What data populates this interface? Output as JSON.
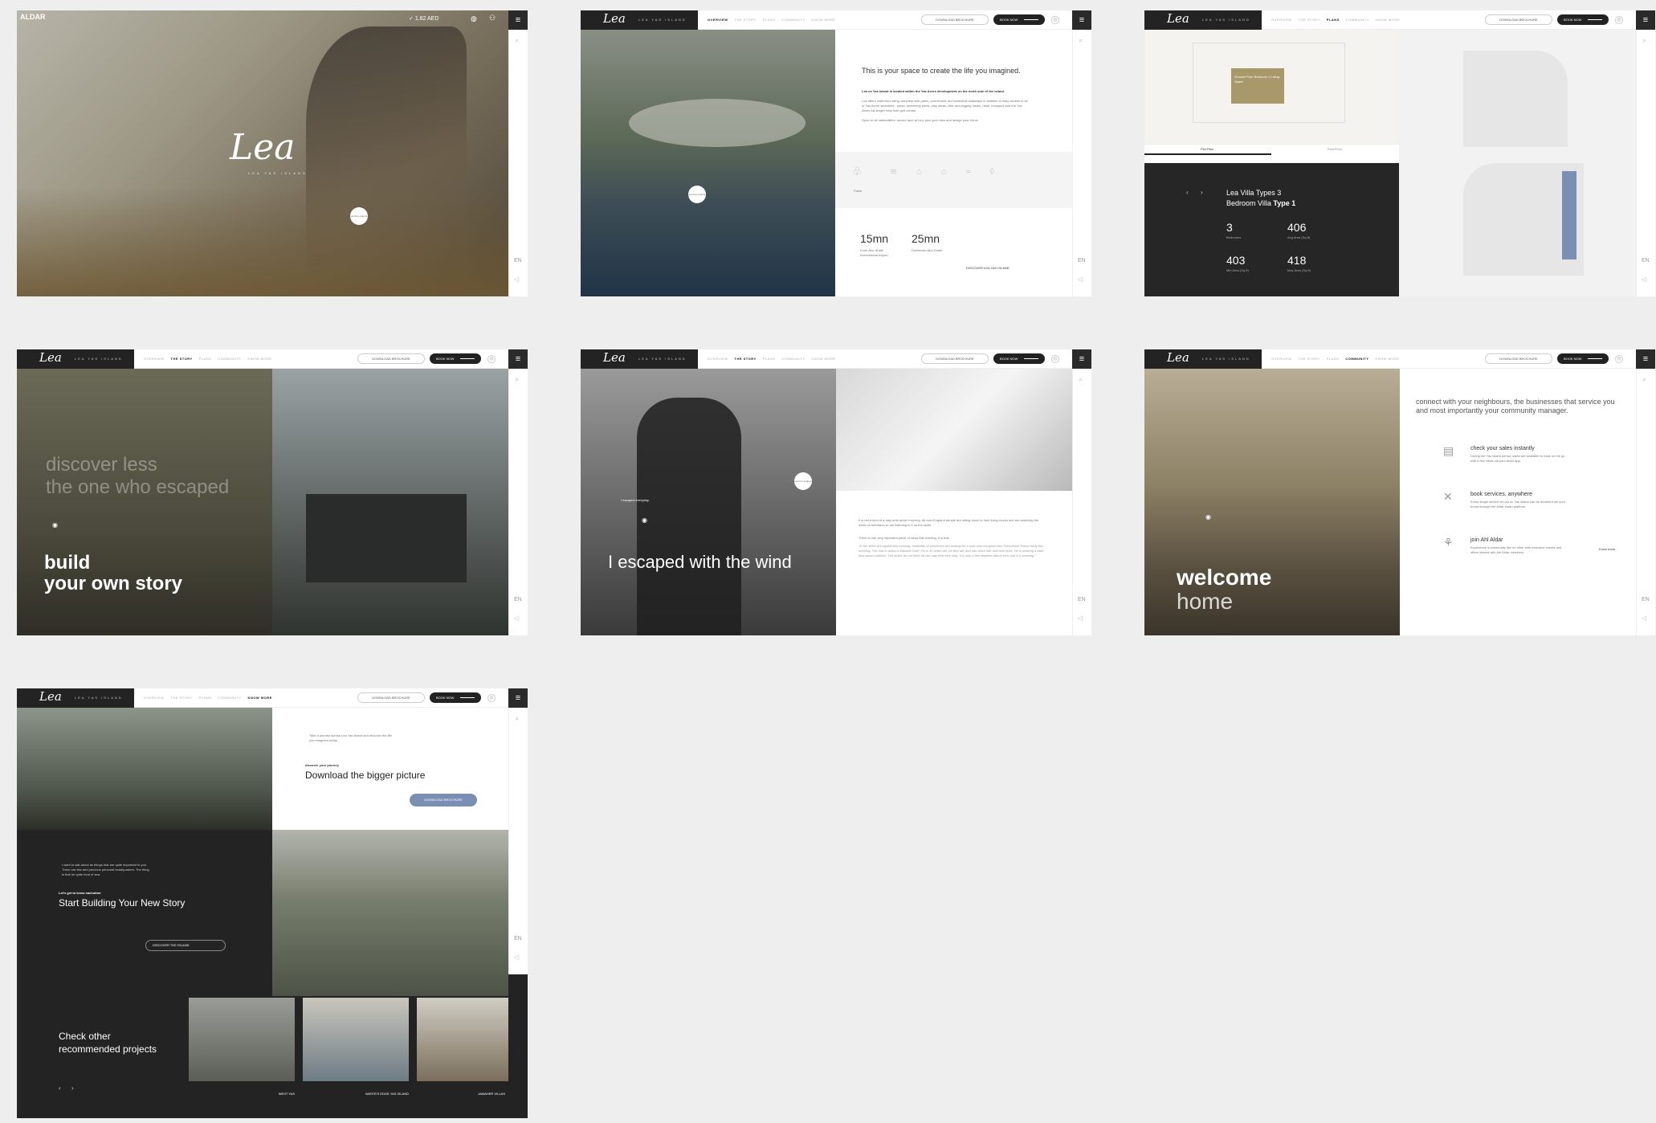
{
  "colors": {
    "dark": "#232323",
    "accent": "#7b8fb5",
    "background": "#eeeeee"
  },
  "common": {
    "logo_script": "Lea",
    "logo_tagline": "LEA YAS ISLAND",
    "nav": [
      "OVERVIEW",
      "THE STORY",
      "PLANS",
      "COMMUNITY",
      "KNOW MORE"
    ],
    "download": "DOWNLOAD BROCHURE",
    "book": "BOOK NOW",
    "lang": "EN"
  },
  "p1": {
    "brand": "ALDAR",
    "stock": "1.82 AED",
    "script": "Lea",
    "sub": "LEA YAS ISLAND",
    "circle": "scroll to explore"
  },
  "p2": {
    "headline": "This is your space to create the life you imagined.",
    "lead": "Lea on Yas Island is located within the Yas Acres development on the north side of the island.",
    "body": "Lea offers waterfront living complete with parks, promenade and waterside walkways in addition to easy access to all of Yas Acres amenities - parks, swimming pools, play areas, bike and jogging tracks, retail, mosques and the Yas Acres full-length sixty hole golf course.",
    "body2": "Open to all nationalities, secure land at Lea, pick your view and design your home.",
    "amenity": "Parks",
    "stat1": "15mn",
    "stat1_label": "From Abu Dhabi International Airport",
    "stat2": "25mn",
    "stat2_label": "Downtown Abu Dhabi",
    "cta": "DISCOVER LEA YAS ISLAND",
    "circle": "scroll to explore"
  },
  "p3": {
    "tab1": "Plot Plan",
    "tab2": "First Floor",
    "title1": "Lea Villa Types 3",
    "title2": "Bedroom Villa",
    "title3": "Type 1",
    "s1": "3",
    "s1l": "Bedrooms",
    "s2": "406",
    "s2l": "Avg Area (Sq ft)",
    "s3": "403",
    "s3l": "Min Area (Sq ft)",
    "s4": "418",
    "s4l": "Max Area (Sq ft)",
    "plan_label": "Ground Floor Bedroom 1 Living Space"
  },
  "p4": {
    "ghost1": "discover less",
    "ghost2": "the one who escaped",
    "title1": "build",
    "title2": "your own story"
  },
  "p5": {
    "small": "I escaped everyday.",
    "title": "I escaped with the wind",
    "circle": "scroll to explore",
    "p1": "It is not a kind of a stay until winter morning. All over England people are sitting down to their living rooms and are watching the news on television or are listening to it on the radio.",
    "p2": "There is one very important piece of news this evening. It is this:",
    "p3": "\"In the West of England this evening, hundreds of policemen are looking for a man who escaped from Princetown Prison early this morning. The man's name is Edward Coke. He is 30 years old, six feet tall, and has black hair and blue eyes. He is wearing a dark blue prison uniform. The police do not think he can stay free very long. It is only a few degrees above zero and it is snowing.\""
  },
  "p6": {
    "title1": "welcome",
    "title2": "home",
    "intro": "connect with your neighbours, the businesses that service you and most importantly your community manager.",
    "f1": "check your sales instantly",
    "f1d": "During the Yas Island period, sales are available to track on the go with a few clicks via your Aldar app.",
    "f2": "book services, anywhere",
    "f2d": "Every single service at Lea on Yas Island can be booked from your home through the Aldar smart platform.",
    "f3": "join Ahl Aldar",
    "f3d": "Experience a community like no other with exclusive events and offers shared with Ahl Aldar members.",
    "know": "Know more"
  },
  "p7": {
    "small": "Take a journey across Lea Yas Island and discover the life you imagined today.",
    "kicker": "discover your journey",
    "title": "Download the bigger picture",
    "btn": "DOWNLOAD BROCHURE",
    "dsmall": "I want to talk about as things that are quite important to you. There are few and precious personal headquarters. The thing is that he quite fond of sea.",
    "dkicker": "Let's get to know eachother",
    "dtitle": "Start Building Your New Story",
    "dbtn": "DISCOVER THE ISLAND",
    "rec1": "Check other",
    "rec2": "recommended projects",
    "proj": [
      "WEST YAS",
      "WATER'S EDGE YAS ISLAND",
      "JAWAHER VILLAS"
    ]
  }
}
